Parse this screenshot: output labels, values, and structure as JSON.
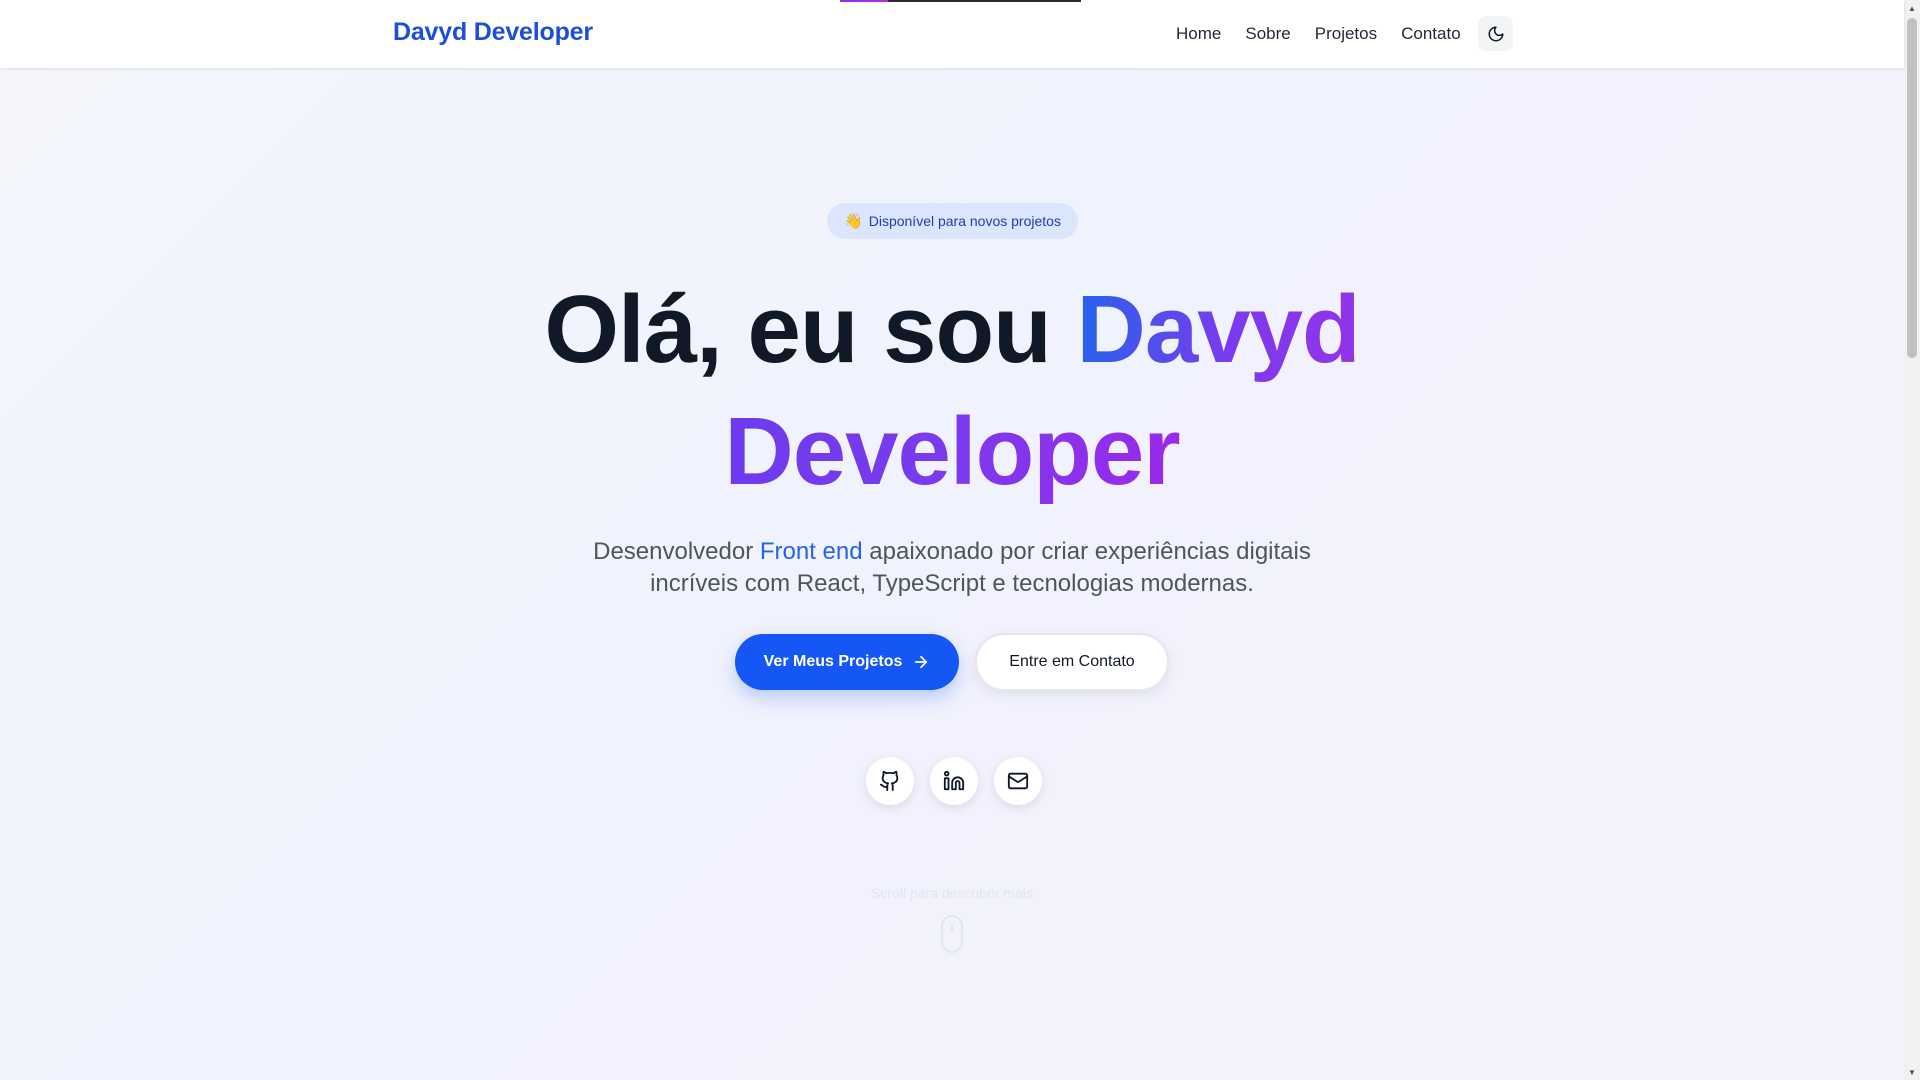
{
  "header": {
    "logo": "Davyd Developer",
    "scroll_progress": 0.2,
    "nav": [
      "Home",
      "Sobre",
      "Projetos",
      "Contato"
    ],
    "theme_toggle_icon": "moon-icon"
  },
  "hero": {
    "badge_emoji": "👋",
    "badge_text": "Disponível para novos projetos",
    "title_prefix": "Olá, eu sou ",
    "title_name_first": "Davyd",
    "title_name_second": "Developer",
    "subtitle_before": "Desenvolvedor ",
    "subtitle_highlight": "Front end",
    "subtitle_after": " apaixonado por criar experiências digitais incríveis com React, TypeScript e tecnologias modernas.",
    "primary_button": "Ver Meus Projetos",
    "primary_button_icon": "arrow-right-icon",
    "secondary_button": "Entre em Contato",
    "socials": [
      "github-icon",
      "linkedin-icon",
      "mail-icon"
    ],
    "scroll_hint": "Scroll para descobrir mais"
  },
  "colors": {
    "brand": "#1d4ed8",
    "primary_button": "#1557f5",
    "gradient_start": "#2563eb",
    "gradient_end": "#9333ea"
  }
}
